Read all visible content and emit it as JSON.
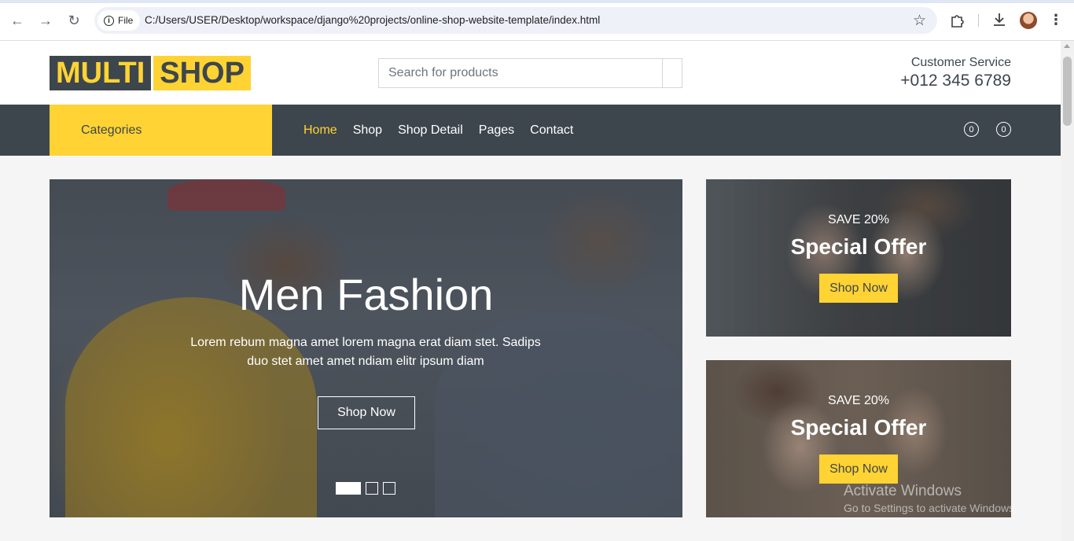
{
  "browser": {
    "file_label": "File",
    "url": "C:/Users/USER/Desktop/workspace/django%20projects/online-shop-website-template/index.html"
  },
  "topbar": {
    "logo_part1": "MULTI",
    "logo_part2": "SHOP",
    "search_placeholder": "Search for products",
    "customer_service_label": "Customer Service",
    "phone": "+012 345 6789"
  },
  "nav": {
    "categories_label": "Categories",
    "items": [
      "Home",
      "Shop",
      "Shop Detail",
      "Pages",
      "Contact"
    ],
    "active_item": "Home",
    "wishlist_count": "0",
    "cart_count": "0"
  },
  "hero": {
    "title": "Men Fashion",
    "text": "Lorem rebum magna amet lorem magna erat diam stet. Sadips duo stet amet amet ndiam elitr ipsum diam",
    "button": "Shop Now",
    "slides": 3,
    "active_slide": 1
  },
  "offers": [
    {
      "save": "SAVE 20%",
      "title": "Special Offer",
      "button": "Shop Now"
    },
    {
      "save": "SAVE 20%",
      "title": "Special Offer",
      "button": "Shop Now"
    }
  ],
  "watermark": {
    "line1": "Activate Windows",
    "line2": "Go to Settings to activate Windows."
  },
  "colors": {
    "primary": "#ffd333",
    "dark": "#3d464d",
    "background": "#f5f5f5"
  }
}
